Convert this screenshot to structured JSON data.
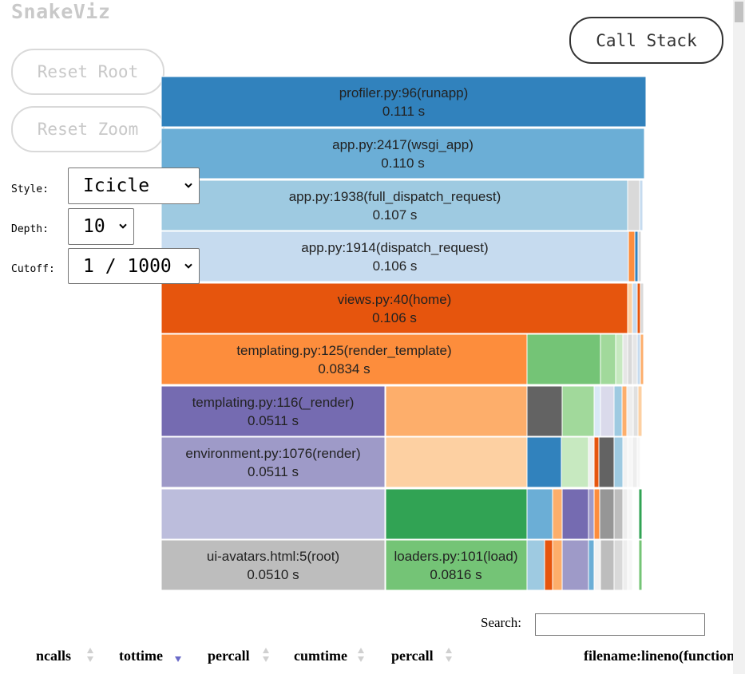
{
  "app": {
    "title": "SnakeViz"
  },
  "buttons": {
    "reset_root": "Reset Root",
    "reset_zoom": "Reset Zoom",
    "call_stack": "Call Stack"
  },
  "controls": {
    "style": {
      "label": "Style:",
      "value": "Icicle"
    },
    "depth": {
      "label": "Depth:",
      "value": "10"
    },
    "cutoff": {
      "label": "Cutoff:",
      "value": "1 / 1000"
    }
  },
  "icicle": {
    "total_time_s": 0.111,
    "labeled_nodes": [
      {
        "name": "profiler.py:96(runapp)",
        "time": "0.111 s",
        "color": "#3182bd"
      },
      {
        "name": "app.py:2417(wsgi_app)",
        "time": "0.110 s",
        "color": "#6baed6"
      },
      {
        "name": "app.py:1938(full_dispatch_request)",
        "time": "0.107 s",
        "color": "#9ecae1"
      },
      {
        "name": "app.py:1914(dispatch_request)",
        "time": "0.106 s",
        "color": "#c6dbef"
      },
      {
        "name": "views.py:40(home)",
        "time": "0.106 s",
        "color": "#e6550d"
      },
      {
        "name": "templating.py:125(render_template)",
        "time": "0.0834 s",
        "color": "#fd8d3c"
      },
      {
        "name": "templating.py:116(_render)",
        "time": "0.0511 s",
        "color": "#756bb1"
      },
      {
        "name": "environment.py:1076(render)",
        "time": "0.0511 s",
        "color": "#9e9ac8"
      },
      {
        "name": "ui-avatars.html:5(root)",
        "time": "0.0510 s",
        "color": "#bdbdbd"
      },
      {
        "name": "loaders.py:101(load)",
        "time": "0.0816 s",
        "color": "#74c476"
      }
    ]
  },
  "search": {
    "label": "Search:",
    "value": ""
  },
  "table": {
    "columns": [
      {
        "label": "ncalls",
        "sort": "none"
      },
      {
        "label": "tottime",
        "sort": "desc"
      },
      {
        "label": "percall",
        "sort": "none"
      },
      {
        "label": "cumtime",
        "sort": "none"
      },
      {
        "label": "percall",
        "sort": "none"
      },
      {
        "label": "filename:lineno(function)",
        "sort": "none"
      }
    ]
  }
}
